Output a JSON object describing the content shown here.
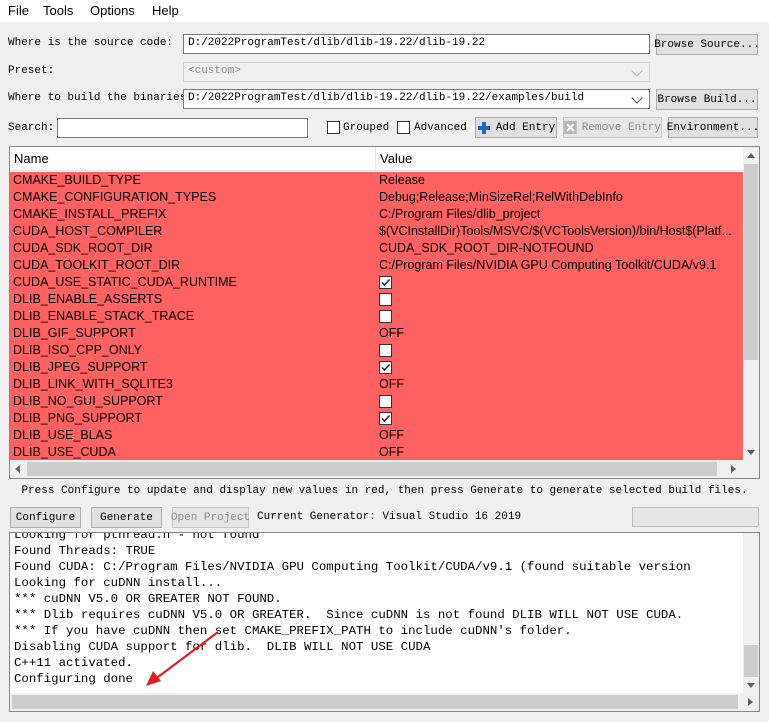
{
  "menu": [
    "File",
    "Tools",
    "Options",
    "Help"
  ],
  "source": {
    "label": "Where is the source code:",
    "value": "D:/2022ProgramTest/dlib/dlib-19.22/dlib-19.22",
    "button": "Browse Source..."
  },
  "preset": {
    "label": "Preset:",
    "value": "<custom>"
  },
  "build": {
    "label": "Where to build the binaries:",
    "value": "D:/2022ProgramTest/dlib/dlib-19.22/dlib-19.22/examples/build",
    "button": "Browse Build..."
  },
  "search": {
    "label": "Search:",
    "value": "",
    "grouped": "Grouped",
    "advanced": "Advanced",
    "add_entry": "Add Entry",
    "remove_entry": "Remove Entry",
    "environment": "Environment..."
  },
  "table": {
    "headers": [
      "Name",
      "Value"
    ],
    "row_color": "#fe6161",
    "rows": [
      {
        "name": "CMAKE_BUILD_TYPE",
        "value": "Release"
      },
      {
        "name": "CMAKE_CONFIGURATION_TYPES",
        "value": "Debug;Release;MinSizeRel;RelWithDebInfo"
      },
      {
        "name": "CMAKE_INSTALL_PREFIX",
        "value": "C:/Program Files/dlib_project"
      },
      {
        "name": "CUDA_HOST_COMPILER",
        "value": "$(VCInstallDir)Tools/MSVC/$(VCToolsVersion)/bin/Host$(Platf..."
      },
      {
        "name": "CUDA_SDK_ROOT_DIR",
        "value": "CUDA_SDK_ROOT_DIR-NOTFOUND"
      },
      {
        "name": "CUDA_TOOLKIT_ROOT_DIR",
        "value": "C:/Program Files/NVIDIA GPU Computing Toolkit/CUDA/v9.1"
      },
      {
        "name": "CUDA_USE_STATIC_CUDA_RUNTIME",
        "checkbox": true,
        "checked": true
      },
      {
        "name": "DLIB_ENABLE_ASSERTS",
        "checkbox": true,
        "checked": false
      },
      {
        "name": "DLIB_ENABLE_STACK_TRACE",
        "checkbox": true,
        "checked": false
      },
      {
        "name": "DLIB_GIF_SUPPORT",
        "value": "OFF"
      },
      {
        "name": "DLIB_ISO_CPP_ONLY",
        "checkbox": true,
        "checked": false
      },
      {
        "name": "DLIB_JPEG_SUPPORT",
        "checkbox": true,
        "checked": true
      },
      {
        "name": "DLIB_LINK_WITH_SQLITE3",
        "value": "OFF"
      },
      {
        "name": "DLIB_NO_GUI_SUPPORT",
        "checkbox": true,
        "checked": false
      },
      {
        "name": "DLIB_PNG_SUPPORT",
        "checkbox": true,
        "checked": true
      },
      {
        "name": "DLIB_USE_BLAS",
        "value": "OFF"
      },
      {
        "name": "DLIB_USE_CUDA",
        "value": "OFF"
      }
    ]
  },
  "hint": "Press Configure to update and display new values in red, then press Generate to generate selected build files.",
  "actions": {
    "configure": "Configure",
    "generate": "Generate",
    "open_project": "Open Project",
    "generator": "Current Generator: Visual Studio 16 2019"
  },
  "output": [
    "Looking for pthread.h - not found",
    "Found Threads: TRUE",
    "Found CUDA: C:/Program Files/NVIDIA GPU Computing Toolkit/CUDA/v9.1 (found suitable version",
    "Looking for cuDNN install...",
    "*** cuDNN V5.0 OR GREATER NOT FOUND.",
    "*** Dlib requires cuDNN V5.0 OR GREATER.  Since cuDNN is not found DLIB WILL NOT USE CUDA.",
    "*** If you have cuDNN then set CMAKE_PREFIX_PATH to include cuDNN's folder.",
    "Disabling CUDA support for dlib.  DLIB WILL NOT USE CUDA",
    "C++11 activated.",
    "Configuring done"
  ],
  "annotation_color": "#e02020"
}
